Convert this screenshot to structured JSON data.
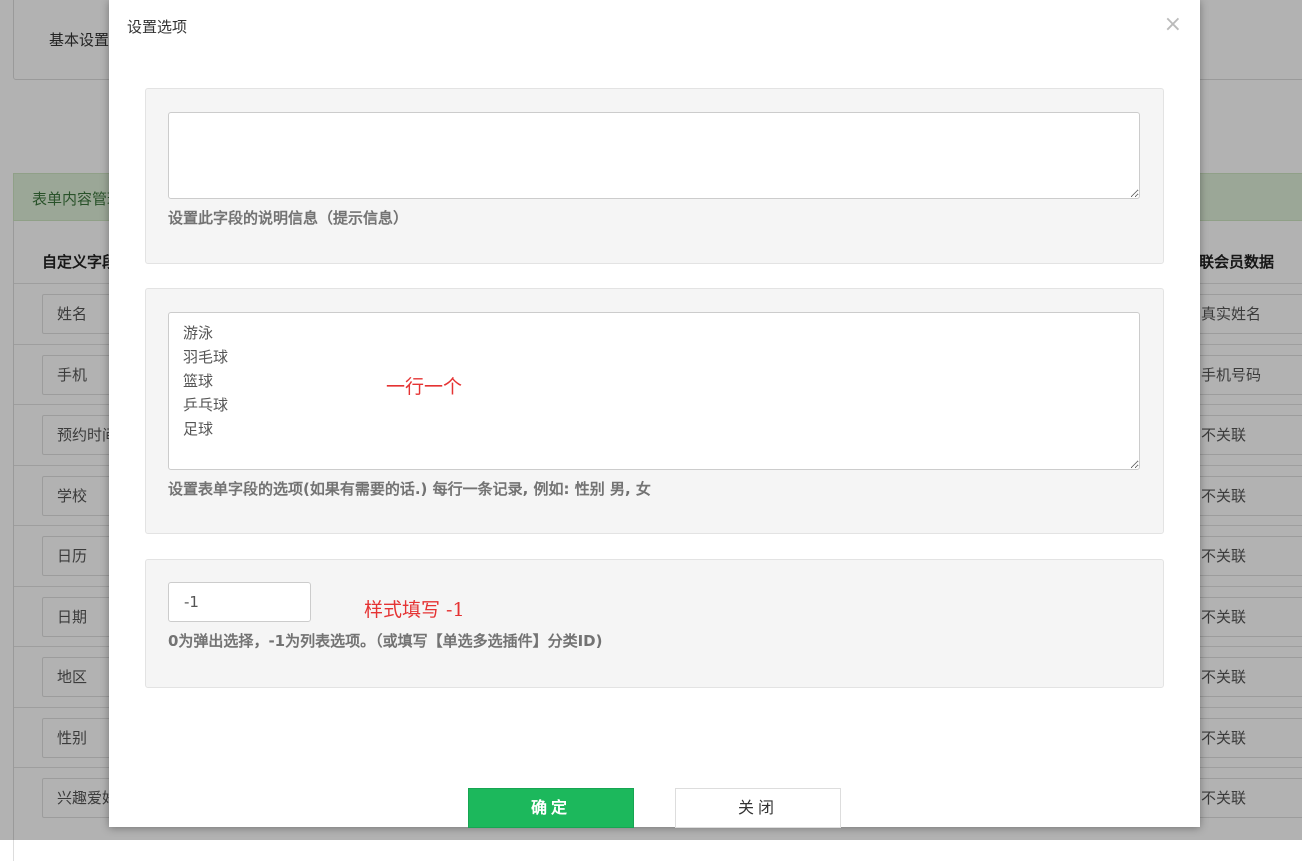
{
  "background": {
    "tab_label": "基本设置",
    "section_header": "表单内容管理",
    "col_left": "自定义字段",
    "col_right": "关联会员数据",
    "rows": [
      {
        "left": "姓名",
        "right": "真实姓名"
      },
      {
        "left": "手机",
        "right": "手机号码"
      },
      {
        "left": "预约时间",
        "right": "不关联"
      },
      {
        "left": "学校",
        "right": "不关联"
      },
      {
        "left": "日历",
        "right": "不关联"
      },
      {
        "left": "日期",
        "right": "不关联"
      },
      {
        "left": "地区",
        "right": "不关联"
      },
      {
        "left": "性别",
        "right": "不关联"
      },
      {
        "left": "兴趣爱好",
        "right": "不关联"
      }
    ]
  },
  "modal": {
    "title": "设置选项",
    "close": "×",
    "description": {
      "value": "",
      "help": "设置此字段的说明信息（提示信息）"
    },
    "options": {
      "value": "游泳\n羽毛球\n篮球\n乒乓球\n足球",
      "annotation": "一行一个",
      "help": "设置表单字段的选项(如果有需要的话.) 每行一条记录, 例如: 性别 男, 女"
    },
    "style": {
      "value": "-1",
      "annotation": "样式填写 -1",
      "help": "0为弹出选择，-1为列表选项。（或填写【单选多选插件】分类ID)"
    },
    "ok_label": "确定",
    "close_label": "关闭"
  }
}
